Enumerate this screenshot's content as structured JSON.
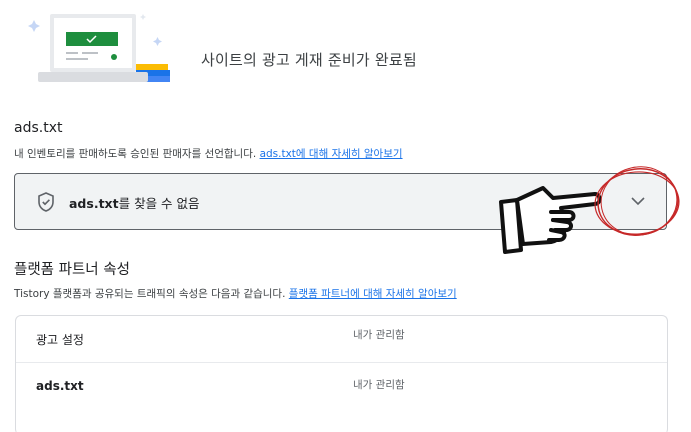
{
  "hero": {
    "title": "사이트의 광고 게재 준비가 완료됨"
  },
  "ads_txt_section": {
    "title": "ads.txt",
    "description": "내 인벤토리를 판매하도록 승인된 판매자를 선언합니다.",
    "learn_more_link": "ads.txt에 대해 자세히 알아보기"
  },
  "status_panel": {
    "label_bold": "ads.txt",
    "label_rest": "를 찾을 수 없음",
    "icon": "shield-icon",
    "expand_icon": "chevron-down-icon"
  },
  "platform_section": {
    "title": "플랫폼 파트너 속성",
    "description": "Tistory 플랫폼과 공유되는 트래픽의 속성은 다음과 같습니다.",
    "learn_more_link": "플랫폼 파트너에 대해 자세히 알아보기",
    "rows": [
      {
        "label": "광고 설정",
        "value": "내가 관리함"
      },
      {
        "label": "ads.txt",
        "value": "내가 관리함"
      }
    ]
  },
  "colors": {
    "link": "#1a73e8",
    "annotation_red": "#c62828",
    "panel_bg": "#f1f3f4"
  }
}
